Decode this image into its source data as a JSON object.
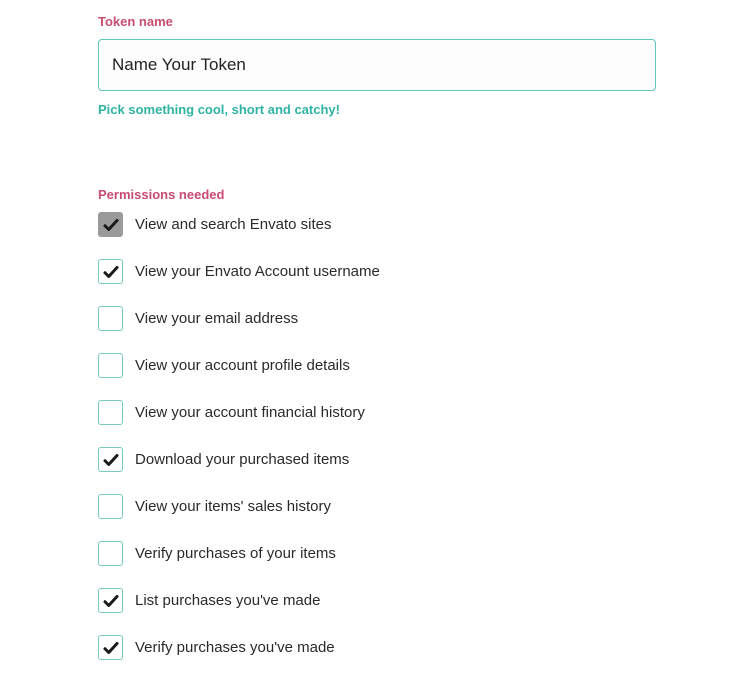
{
  "token_name": {
    "label": "Token name",
    "value": "Name Your Token",
    "hint": "Pick something cool, short and catchy!"
  },
  "permissions": {
    "label": "Permissions needed",
    "items": [
      {
        "label": "View and search Envato sites",
        "checked": true,
        "disabled": true
      },
      {
        "label": "View your Envato Account username",
        "checked": true,
        "disabled": false
      },
      {
        "label": "View your email address",
        "checked": false,
        "disabled": false
      },
      {
        "label": "View your account profile details",
        "checked": false,
        "disabled": false
      },
      {
        "label": "View your account financial history",
        "checked": false,
        "disabled": false
      },
      {
        "label": "Download your purchased items",
        "checked": true,
        "disabled": false
      },
      {
        "label": "View your items' sales history",
        "checked": false,
        "disabled": false
      },
      {
        "label": "Verify purchases of your items",
        "checked": false,
        "disabled": false
      },
      {
        "label": "List purchases you've made",
        "checked": true,
        "disabled": false
      },
      {
        "label": "Verify purchases you've made",
        "checked": true,
        "disabled": false
      }
    ]
  }
}
